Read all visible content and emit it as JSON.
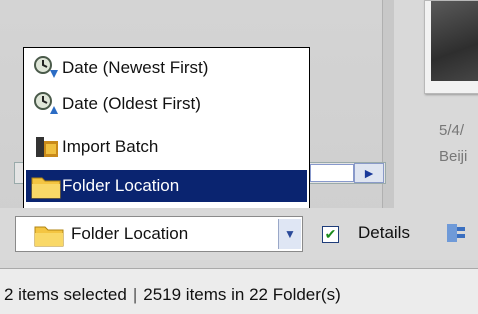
{
  "menu": {
    "items": [
      {
        "label": "Date (Newest First)",
        "icon": "clock-arrow-icon"
      },
      {
        "label": "Date (Oldest First)",
        "icon": "clock-arrow-icon"
      },
      {
        "label": "Import Batch",
        "icon": "film-roll-icon"
      },
      {
        "label": "Folder Location",
        "icon": "folder-icon",
        "selected": true
      }
    ]
  },
  "sort_combo": {
    "value": "Folder Location",
    "icon": "folder-icon"
  },
  "details": {
    "label": "Details",
    "checked": true
  },
  "thumbnail": {
    "date_text": "5/4/",
    "location_text": "Beiji"
  },
  "status": {
    "selected": "2 items selected",
    "separator": "|",
    "summary": "2519 items in 22 Folder(s)"
  },
  "colors": {
    "selection": "#0a2470",
    "folder": "#f4c542",
    "check": "#1a8a1a"
  }
}
